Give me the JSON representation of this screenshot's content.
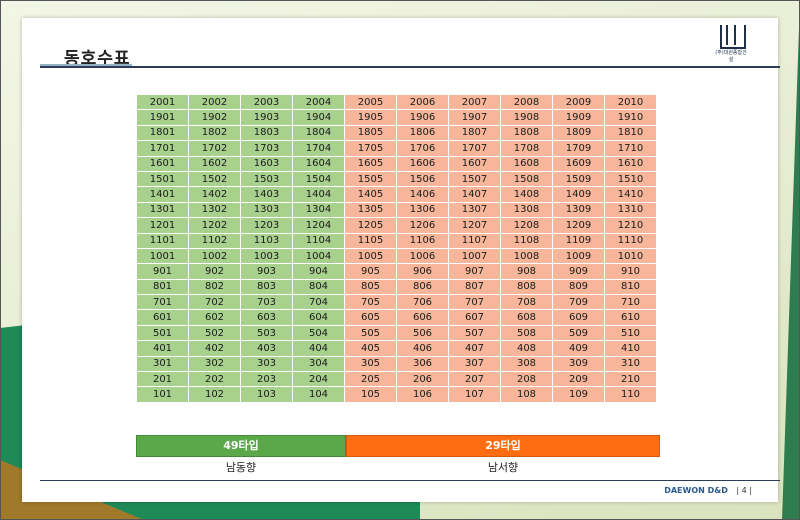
{
  "title": "동호수표",
  "logo_text": "(주)대원종합건설",
  "footer": {
    "brand": "DAEWON D&D",
    "page": "| 4 |"
  },
  "rows": [
    [
      "2001",
      "2002",
      "2003",
      "2004",
      "2005",
      "2006",
      "2007",
      "2008",
      "2009",
      "2010"
    ],
    [
      "1901",
      "1902",
      "1903",
      "1904",
      "1905",
      "1906",
      "1907",
      "1908",
      "1909",
      "1910"
    ],
    [
      "1801",
      "1802",
      "1803",
      "1804",
      "1805",
      "1806",
      "1807",
      "1808",
      "1809",
      "1810"
    ],
    [
      "1701",
      "1702",
      "1703",
      "1704",
      "1705",
      "1706",
      "1707",
      "1708",
      "1709",
      "1710"
    ],
    [
      "1601",
      "1602",
      "1603",
      "1604",
      "1605",
      "1606",
      "1607",
      "1608",
      "1609",
      "1610"
    ],
    [
      "1501",
      "1502",
      "1503",
      "1504",
      "1505",
      "1506",
      "1507",
      "1508",
      "1509",
      "1510"
    ],
    [
      "1401",
      "1402",
      "1403",
      "1404",
      "1405",
      "1406",
      "1407",
      "1408",
      "1409",
      "1410"
    ],
    [
      "1301",
      "1302",
      "1303",
      "1304",
      "1305",
      "1306",
      "1307",
      "1308",
      "1309",
      "1310"
    ],
    [
      "1201",
      "1202",
      "1203",
      "1204",
      "1205",
      "1206",
      "1207",
      "1208",
      "1209",
      "1210"
    ],
    [
      "1101",
      "1102",
      "1103",
      "1104",
      "1105",
      "1106",
      "1107",
      "1108",
      "1109",
      "1110"
    ],
    [
      "1001",
      "1002",
      "1003",
      "1004",
      "1005",
      "1006",
      "1007",
      "1008",
      "1009",
      "1010"
    ],
    [
      "901",
      "902",
      "903",
      "904",
      "905",
      "906",
      "907",
      "908",
      "909",
      "910"
    ],
    [
      "801",
      "802",
      "803",
      "804",
      "805",
      "806",
      "807",
      "808",
      "809",
      "810"
    ],
    [
      "701",
      "702",
      "703",
      "704",
      "705",
      "706",
      "707",
      "708",
      "709",
      "710"
    ],
    [
      "601",
      "602",
      "603",
      "604",
      "605",
      "606",
      "607",
      "608",
      "609",
      "610"
    ],
    [
      "501",
      "502",
      "503",
      "504",
      "505",
      "506",
      "507",
      "508",
      "509",
      "510"
    ],
    [
      "401",
      "402",
      "403",
      "404",
      "405",
      "406",
      "407",
      "408",
      "409",
      "410"
    ],
    [
      "301",
      "302",
      "303",
      "304",
      "305",
      "306",
      "307",
      "308",
      "309",
      "310"
    ],
    [
      "201",
      "202",
      "203",
      "204",
      "205",
      "206",
      "207",
      "208",
      "209",
      "210"
    ],
    [
      "101",
      "102",
      "103",
      "104",
      "105",
      "106",
      "107",
      "108",
      "109",
      "110"
    ]
  ],
  "type_49": {
    "label": "49타입",
    "direction": "남동향",
    "color": "#a9d18e"
  },
  "type_29": {
    "label": "29타입",
    "direction": "남서향",
    "color": "#f7b69a"
  }
}
